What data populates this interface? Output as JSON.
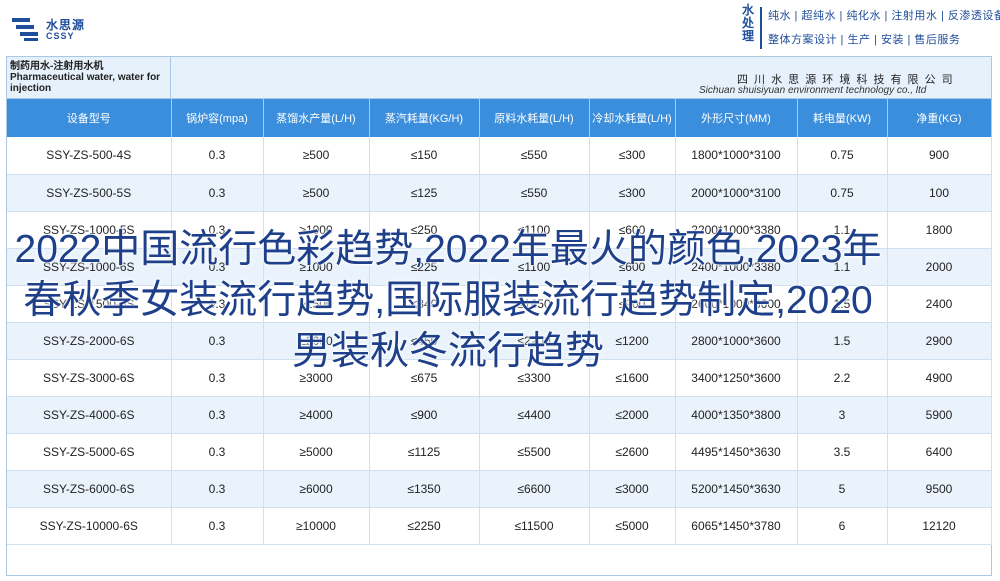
{
  "brand": {
    "name_cn": "水思源",
    "name_en": "CSSY",
    "color": "#1f4e9a"
  },
  "services": {
    "tag": "水处理",
    "line1": "纯水 | 超纯水 | 纯化水 | 注射用水 | 反渗透设备",
    "line2": "整体方案设计 | 生产 | 安装 | 售后服务"
  },
  "product_title": "制药用水-注射用水机 Pharmaceutical water, water for injection",
  "company": {
    "name_cn": "四 川 水 思 源 环 境 科 技 有 限 公 司",
    "name_en": "Sichuan shuisiyuan environment technology co., ltd"
  },
  "table": {
    "header_color": "#3b8edb",
    "columns": [
      "设备型号",
      "锅炉容(mpa)",
      "蒸馏水产量(L/H)",
      "蒸汽耗量(KG/H)",
      "原料水耗量(L/H)",
      "冷却水耗量(L/H)",
      "外形尺寸(MM)",
      "耗电量(KW)",
      "净重(KG)"
    ],
    "rows": [
      [
        "SSY-ZS-500-4S",
        "0.3",
        "≥500",
        "≤150",
        "≤550",
        "≤300",
        "1800*1000*3100",
        "0.75",
        "900"
      ],
      [
        "SSY-ZS-500-5S",
        "0.3",
        "≥500",
        "≤125",
        "≤550",
        "≤300",
        "2000*1000*3100",
        "0.75",
        "100"
      ],
      [
        "SSY-ZS-1000-5S",
        "0.3",
        "≥1000",
        "≤250",
        "≤1100",
        "≤600",
        "2200*1000*3380",
        "1.1",
        "1800"
      ],
      [
        "SSY-ZS-1000-6S",
        "0.3",
        "≥1000",
        "≤225",
        "≤1100",
        "≤600",
        "2400*1000*3380",
        "1.1",
        "2000"
      ],
      [
        "SSY-ZS-1500-6S",
        "0.3",
        "≥1500",
        "≤340",
        "≤1650",
        "≤900",
        "2600*1000*3600",
        "1.5",
        "2400"
      ],
      [
        "SSY-ZS-2000-6S",
        "0.3",
        "≥2000",
        "≤450",
        "≤2200",
        "≤1200",
        "2800*1000*3600",
        "1.5",
        "2900"
      ],
      [
        "SSY-ZS-3000-6S",
        "0.3",
        "≥3000",
        "≤675",
        "≤3300",
        "≤1600",
        "3400*1250*3600",
        "2.2",
        "4900"
      ],
      [
        "SSY-ZS-4000-6S",
        "0.3",
        "≥4000",
        "≤900",
        "≤4400",
        "≤2000",
        "4000*1350*3800",
        "3",
        "5900"
      ],
      [
        "SSY-ZS-5000-6S",
        "0.3",
        "≥5000",
        "≤1125",
        "≤5500",
        "≤2600",
        "4495*1450*3630",
        "3.5",
        "6400"
      ],
      [
        "SSY-ZS-6000-6S",
        "0.3",
        "≥6000",
        "≤1350",
        "≤6600",
        "≤3000",
        "5200*1450*3630",
        "5",
        "9500"
      ],
      [
        "SSY-ZS-10000-6S",
        "0.3",
        "≥10000",
        "≤2250",
        "≤11500",
        "≤5000",
        "6065*1450*3780",
        "6",
        "12120"
      ]
    ]
  },
  "overlay_text": "2022中国流行色彩趋势,2022年最火的颜色,2023年春秋季女装流行趋势,国际服装流行趋势制定,2020男装秋冬流行趋势"
}
